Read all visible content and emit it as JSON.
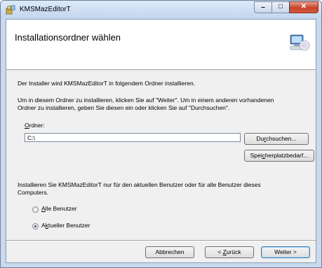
{
  "window": {
    "title": "KMSMazEditorT",
    "close_glyph": "✕",
    "minimize_glyph": "–",
    "maximize_glyph": "□"
  },
  "banner": {
    "title": "Installationsordner wählen",
    "icon": "computer-cd-icon"
  },
  "body": {
    "intro": "Der Installer wird KMSMazEditorT in folgendem Ordner installieren.",
    "instructions_line1": "Um in diesem Ordner zu installieren, klicken Sie auf \"Weiter\". Um in einem anderen vorhandenen",
    "instructions_line2": "Ordner zu installieren, geben Sie diesen ein oder klicken Sie auf \"Durchsuchen\"."
  },
  "folder": {
    "label_accel": "O",
    "label_rest": "rdner:",
    "value": "C:\\"
  },
  "buttons": {
    "browse_pre": "Du",
    "browse_accel": "r",
    "browse_post": "chsuchen...",
    "diskcost_pre": "Spei",
    "diskcost_accel": "c",
    "diskcost_post": "herplatzbedarf...",
    "cancel": "Abbrechen",
    "back_pre": "< ",
    "back_accel": "Z",
    "back_post": "urück",
    "next": "Weiter >"
  },
  "scope": {
    "question_line1": "Installieren Sie KMSMazEditorT nur für den aktuellen Benutzer oder für alle Benutzer dieses",
    "question_line2": "Computers.",
    "all_accel": "A",
    "all_rest": "lle Benutzer",
    "current_pre": "A",
    "current_accel": "k",
    "current_post": "tueller Benutzer",
    "selected": "current"
  }
}
